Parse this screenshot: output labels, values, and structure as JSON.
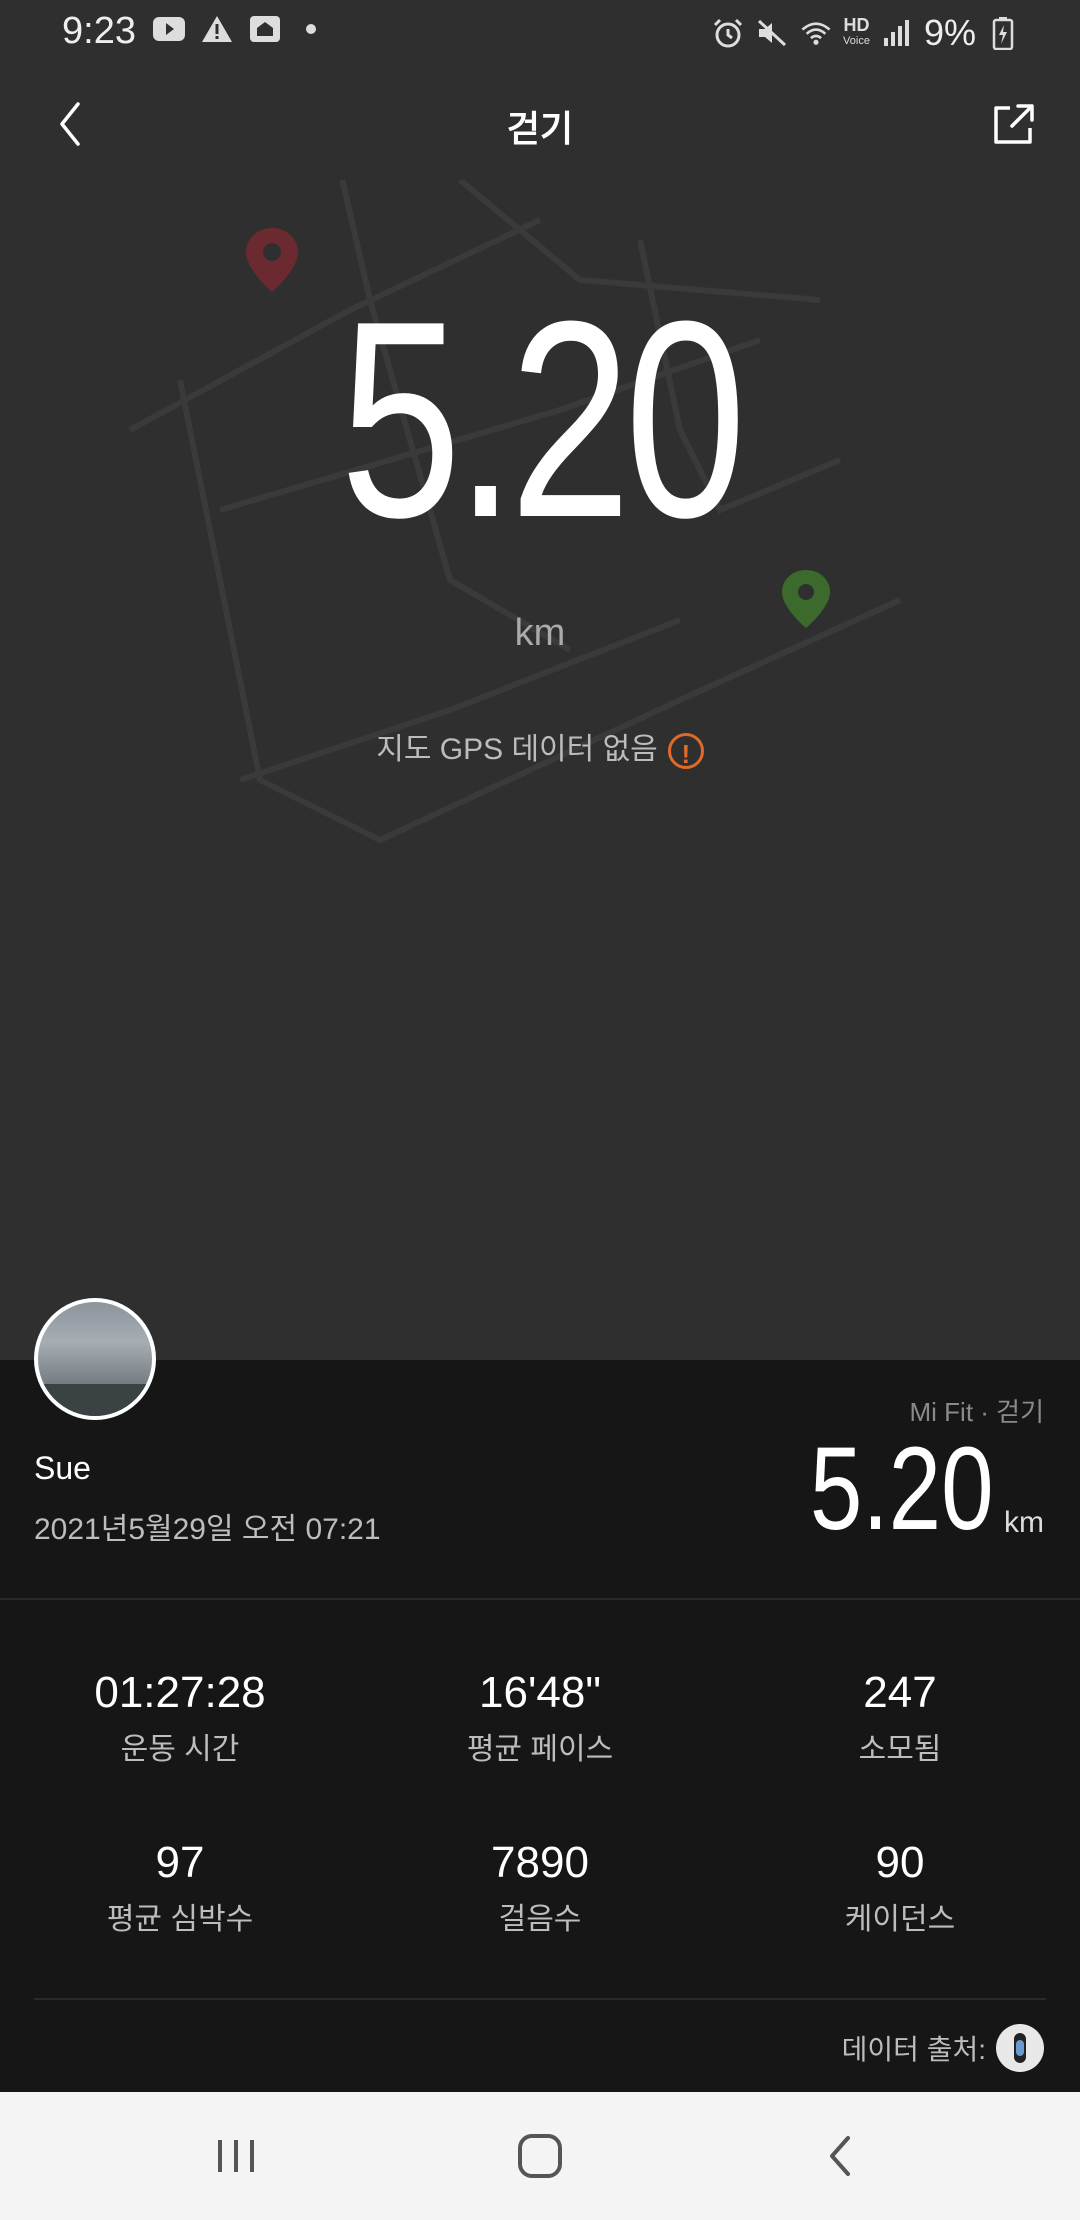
{
  "status_bar": {
    "time": "9:23",
    "battery_percent": "9%",
    "hd_label": "HD",
    "voice_label": "Voice"
  },
  "app_bar": {
    "title": "걷기"
  },
  "hero": {
    "distance": "5.20",
    "unit": "km",
    "gps_note": "지도 GPS 데이터 없음",
    "warning_glyph": "!"
  },
  "summary": {
    "user_name": "Sue",
    "date": "2021년5월29일 오전 07:21",
    "source": "Mi Fit · 걷기",
    "distance": "5.20",
    "unit": "km"
  },
  "stats": [
    {
      "value": "01:27:28",
      "label": "운동 시간"
    },
    {
      "value": "16'48\"",
      "label": "평균 페이스"
    },
    {
      "value": "247",
      "label": "소모됨"
    },
    {
      "value": "97",
      "label": "평균 심박수"
    },
    {
      "value": "7890",
      "label": "걸음수"
    },
    {
      "value": "90",
      "label": "케이던스"
    }
  ],
  "data_source_label": "데이터 출처:",
  "colors": {
    "background": "#2f2f30",
    "card": "#161616",
    "warning": "#e06a2a",
    "start_pin": "#7a2a32",
    "end_pin": "#3b6a2c"
  }
}
